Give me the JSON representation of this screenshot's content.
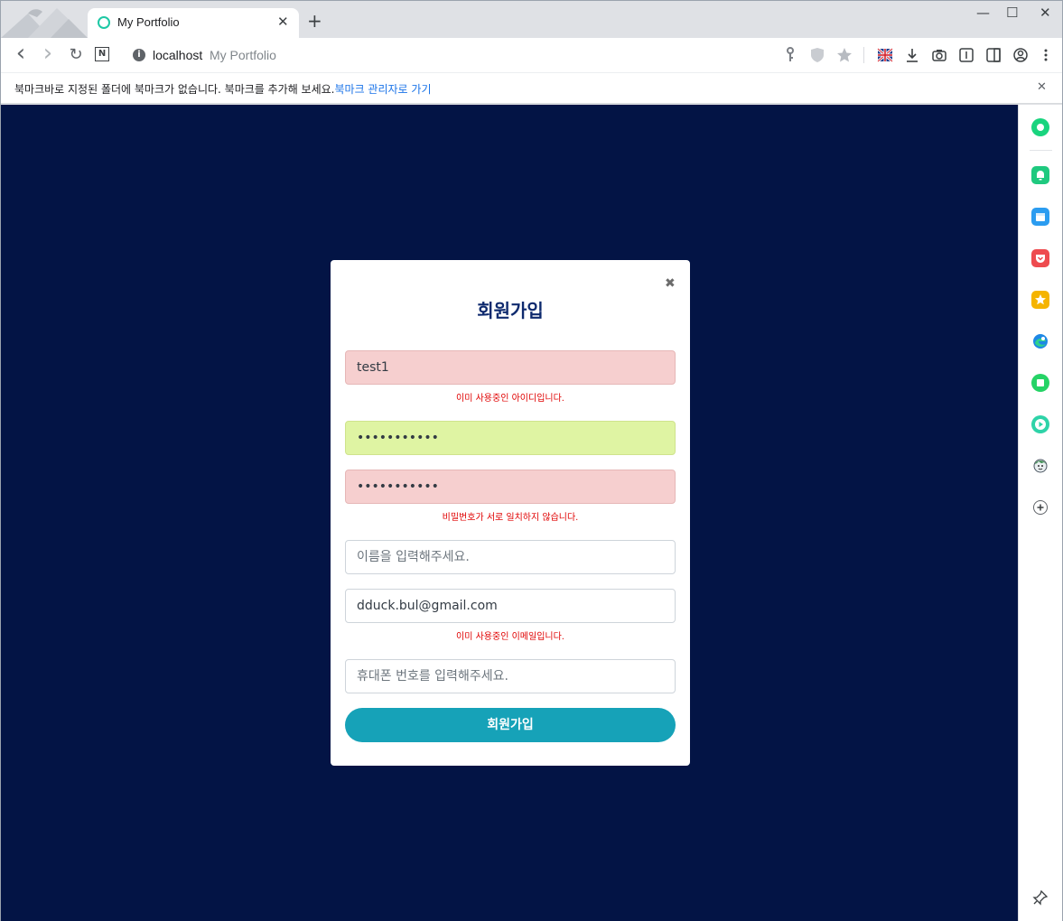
{
  "browser": {
    "tab": {
      "title": "My Portfolio",
      "close": "✕"
    },
    "new_tab": "+",
    "window_controls": {
      "minimize": "—",
      "maximize": "☐",
      "close": "✕"
    },
    "address": {
      "host": "localhost",
      "page_title": "My Portfolio",
      "info": "i"
    },
    "nav": {
      "back": "‹",
      "forward": "›",
      "reload": "↻",
      "n_icon": "N"
    }
  },
  "bookmark_bar": {
    "message": "북마크바로 지정된 폴더에 북마크가 없습니다. 북마크를 추가해 보세요.",
    "link": "북마크 관리자로 가기",
    "close": "✕"
  },
  "modal": {
    "close": "✖",
    "title": "회원가입",
    "fields": {
      "id": {
        "value": "test1",
        "error": "이미 사용중인 아이디입니다."
      },
      "password": {
        "value": "•••••••••••"
      },
      "password_confirm": {
        "value": "•••••••••••",
        "error": "비밀번호가 서로 일치하지 않습니다."
      },
      "name": {
        "placeholder": "이름을 입력해주세요."
      },
      "email": {
        "value": "dduck.bul@gmail.com",
        "error": "이미 사용중인 이메일입니다."
      },
      "phone": {
        "placeholder": "휴대폰 번호를 입력해주세요."
      }
    },
    "submit": "회원가입"
  },
  "colors": {
    "page_bg": "#031445",
    "invalid_bg": "#f6cfcf",
    "valid_bg": "#dff4a3",
    "error": "#e00000",
    "submit": "#16a2b8",
    "title": "#0e2a6e"
  },
  "side_panel_icons": [
    "whale-icon",
    "bell-icon",
    "calendar-icon",
    "pocket-icon",
    "star-icon",
    "edge-icon",
    "note-icon",
    "play-icon",
    "avatar-icon",
    "plus-icon",
    "pin-icon"
  ]
}
